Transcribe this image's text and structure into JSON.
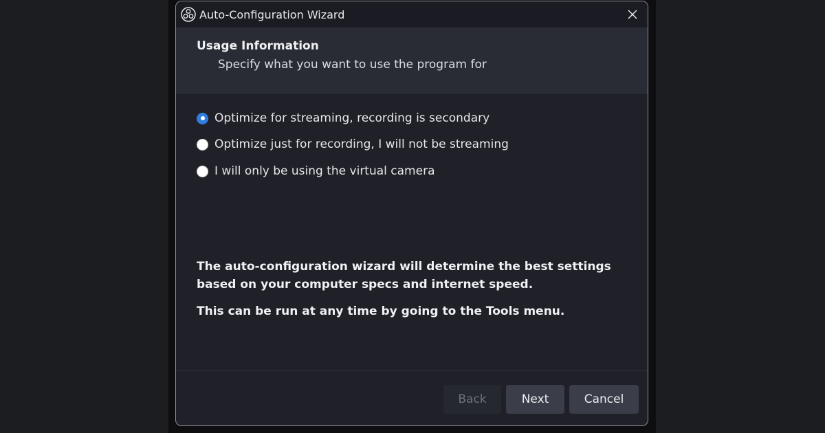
{
  "window": {
    "title": "Auto-Configuration Wizard"
  },
  "header": {
    "title": "Usage Information",
    "subtitle": "Specify what you want to use the program for"
  },
  "options": [
    {
      "label": "Optimize for streaming, recording is secondary",
      "checked": true
    },
    {
      "label": "Optimize just for recording, I will not be streaming",
      "checked": false
    },
    {
      "label": "I will only be using the virtual camera",
      "checked": false
    }
  ],
  "info": {
    "line1": "The auto-configuration wizard will determine the best settings based on your computer specs and internet speed.",
    "line2": "This can be run at any time by going to the Tools menu."
  },
  "buttons": {
    "back": "Back",
    "next": "Next",
    "cancel": "Cancel"
  },
  "colors": {
    "accent": "#2f7de0",
    "window_bg": "#1f2028",
    "header_bg": "#2a2c35",
    "button_bg": "#3b3e49"
  },
  "icons": {
    "app": "obs-logo-icon",
    "close": "close-icon"
  }
}
